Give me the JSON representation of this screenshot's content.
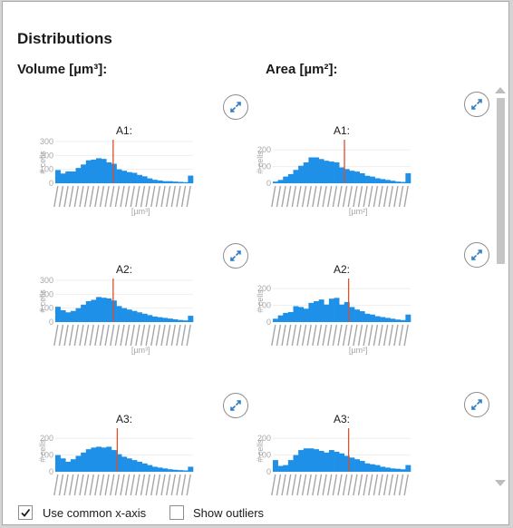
{
  "panel": {
    "title": "Distributions",
    "volume_title": "Volume [µm³]:",
    "area_title": "Area [µm²]:"
  },
  "options": {
    "common_axis_label": "Use common x-axis",
    "common_axis_checked": true,
    "outliers_label": "Show outliers",
    "outliers_checked": false
  },
  "colors": {
    "bar": "#1e90e8",
    "marker": "#d9502a",
    "tick_label": "#a6a6a6"
  },
  "chart_data": [
    {
      "type": "bar",
      "title": "A1:",
      "ylabel": "# cells",
      "xlabel": "[µm³]",
      "ylim": [
        0,
        300
      ],
      "yticks": [
        "300",
        "200",
        "100",
        "0"
      ],
      "values": [
        95,
        70,
        85,
        85,
        110,
        135,
        165,
        170,
        180,
        175,
        150,
        140,
        100,
        90,
        80,
        75,
        60,
        50,
        35,
        25,
        20,
        15,
        15,
        12,
        10,
        8,
        55
      ],
      "marker_fraction": 0.42
    },
    {
      "type": "bar",
      "title": "A1:",
      "ylabel": "# cells",
      "xlabel": "[µm²]",
      "ylim": [
        0,
        250
      ],
      "yticks": [
        "200",
        "100",
        "0"
      ],
      "values": [
        10,
        20,
        40,
        55,
        80,
        105,
        125,
        155,
        155,
        145,
        135,
        130,
        125,
        95,
        85,
        75,
        70,
        60,
        45,
        40,
        30,
        25,
        20,
        15,
        10,
        8,
        60
      ],
      "marker_fraction": 0.52
    },
    {
      "type": "bar",
      "title": "A2:",
      "ylabel": "# cells",
      "xlabel": "[µm³]",
      "ylim": [
        0,
        300
      ],
      "yticks": [
        "300",
        "200",
        "100",
        "0"
      ],
      "values": [
        110,
        85,
        70,
        80,
        100,
        125,
        150,
        160,
        180,
        175,
        170,
        155,
        115,
        100,
        90,
        80,
        70,
        60,
        50,
        40,
        35,
        30,
        25,
        20,
        15,
        12,
        45
      ],
      "marker_fraction": 0.42
    },
    {
      "type": "bar",
      "title": "A2:",
      "ylabel": "# cells",
      "xlabel": "[µm²]",
      "ylim": [
        0,
        250
      ],
      "yticks": [
        "200",
        "100",
        "0"
      ],
      "values": [
        20,
        40,
        55,
        60,
        95,
        90,
        80,
        115,
        125,
        135,
        105,
        140,
        145,
        105,
        120,
        90,
        75,
        65,
        50,
        45,
        35,
        30,
        25,
        20,
        15,
        12,
        45
      ],
      "marker_fraction": 0.55
    },
    {
      "type": "bar",
      "title": "A3:",
      "ylabel": "# cells",
      "xlabel": "",
      "ylim": [
        0,
        250
      ],
      "yticks": [
        "200",
        "100",
        "0"
      ],
      "values": [
        100,
        80,
        60,
        75,
        95,
        115,
        135,
        145,
        150,
        145,
        150,
        130,
        105,
        90,
        80,
        70,
        60,
        50,
        40,
        30,
        25,
        20,
        15,
        12,
        10,
        8,
        30
      ],
      "marker_fraction": 0.45
    },
    {
      "type": "bar",
      "title": "A3:",
      "ylabel": "# cells",
      "xlabel": "",
      "ylim": [
        0,
        250
      ],
      "yticks": [
        "200",
        "100",
        "0"
      ],
      "values": [
        70,
        35,
        40,
        70,
        100,
        130,
        140,
        140,
        135,
        125,
        115,
        130,
        120,
        110,
        95,
        85,
        75,
        65,
        50,
        45,
        40,
        30,
        25,
        20,
        18,
        15,
        40
      ],
      "marker_fraction": 0.55
    }
  ]
}
